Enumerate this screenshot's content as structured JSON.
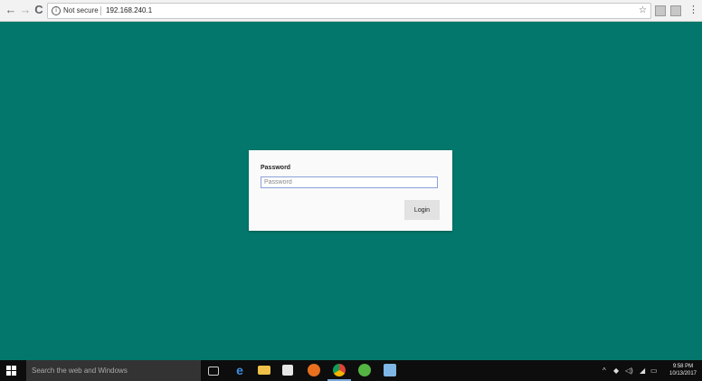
{
  "browser": {
    "back": "←",
    "forward": "→",
    "reload": "C",
    "security_label": "Not secure",
    "url": "192.168.240.1",
    "bookmark_star": "☆",
    "menu": "⋮"
  },
  "login_form": {
    "field_label": "Password",
    "password_placeholder": "Password",
    "login_button": "Login"
  },
  "taskbar": {
    "search_placeholder": "Search the web and Windows",
    "clock_time": "9:58 PM",
    "clock_date": "10/13/2017"
  },
  "colors": {
    "page_background": "#03776b",
    "taskbar": "#0d0d0d"
  }
}
